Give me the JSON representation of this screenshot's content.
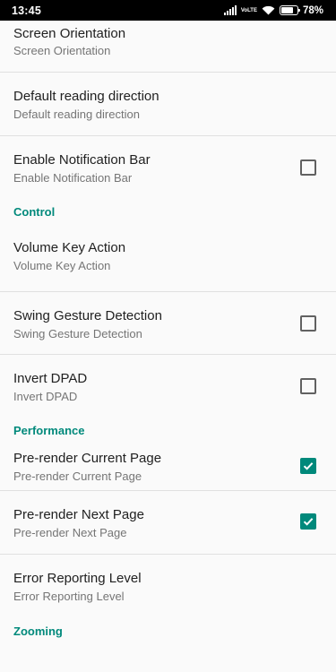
{
  "status_bar": {
    "time": "13:45",
    "battery_percent": "78%",
    "battery_level": 0.78,
    "network_label": "VoLTE"
  },
  "preferences": {
    "screen_orientation": {
      "title": "Screen Orientation",
      "summary": "Screen Orientation"
    },
    "reading_direction": {
      "title": "Default reading direction",
      "summary": "Default reading direction"
    },
    "notification_bar": {
      "title": "Enable Notification Bar",
      "summary": "Enable Notification Bar",
      "checked": false
    },
    "control_header": "Control",
    "volume_key": {
      "title": "Volume Key Action",
      "summary": "Volume Key Action"
    },
    "swing_gesture": {
      "title": "Swing Gesture Detection",
      "summary": "Swing Gesture Detection",
      "checked": false
    },
    "invert_dpad": {
      "title": "Invert DPAD",
      "summary": "Invert DPAD",
      "checked": false
    },
    "performance_header": "Performance",
    "prerender_current": {
      "title": "Pre-render Current Page",
      "summary": "Pre-render Current Page",
      "checked": true
    },
    "prerender_next": {
      "title": "Pre-render Next Page",
      "summary": "Pre-render Next Page",
      "checked": true
    },
    "error_reporting": {
      "title": "Error Reporting Level",
      "summary": "Error Reporting Level"
    },
    "zooming_header": "Zooming"
  },
  "colors": {
    "accent": "#00897b",
    "title_text": "#212121",
    "summary_text": "#757575",
    "divider": "#e0e0e0",
    "background": "#fafafa"
  }
}
